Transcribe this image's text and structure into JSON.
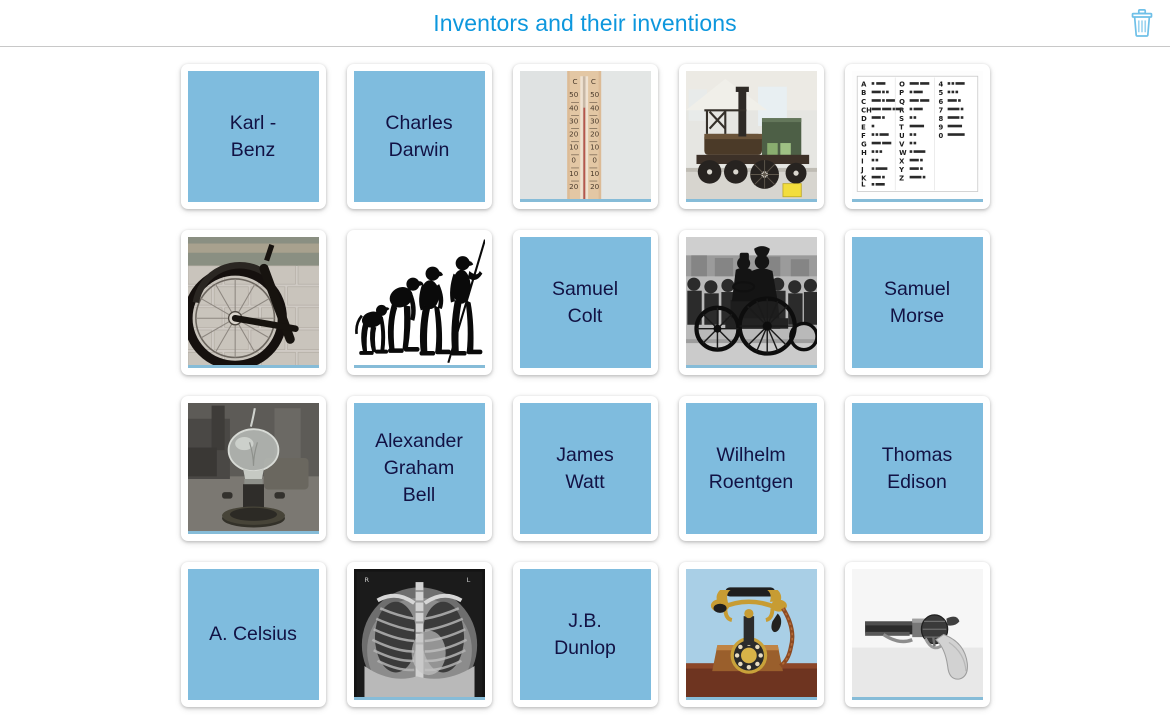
{
  "header": {
    "title": "Inventors and their inventions",
    "title_color": "#0d97dd",
    "delete_icon": "trash-icon",
    "delete_icon_color": "#6fc0e8",
    "delete_label": "Delete"
  },
  "theme": {
    "tile_color": "#7fbcde",
    "tile_text_color": "#121244",
    "card_background": "#ffffff",
    "page_background": "#ffffff",
    "image_underline_color": "#86bcd8",
    "header_rule_color": "#c8c8c8"
  },
  "grid": {
    "columns": 5,
    "rows": 4,
    "total_cards": 20
  },
  "cards": [
    {
      "id": 1,
      "type": "text",
      "label": "Karl -\nBenz",
      "name": "card-karl-benz"
    },
    {
      "id": 2,
      "type": "text",
      "label": "Charles\nDarwin",
      "name": "card-charles-darwin"
    },
    {
      "id": 3,
      "type": "image",
      "art": "thermometer",
      "alt": "Wooden wall thermometer in Celsius",
      "name": "card-thermometer"
    },
    {
      "id": 4,
      "type": "image",
      "art": "locomotive",
      "alt": "Early steam locomotive in a museum",
      "name": "card-steam-locomotive"
    },
    {
      "id": 5,
      "type": "image",
      "art": "morse-chart",
      "alt": "Morse code alphabet chart",
      "name": "card-morse-code-chart"
    },
    {
      "id": 6,
      "type": "image",
      "art": "bicycle",
      "alt": "Bicycle wheel with pneumatic tyre",
      "name": "card-bicycle-wheel"
    },
    {
      "id": 7,
      "type": "image",
      "art": "evolution",
      "alt": "Evolution of man silhouettes",
      "name": "card-evolution"
    },
    {
      "id": 8,
      "type": "text",
      "label": "Samuel\nColt",
      "name": "card-samuel-colt"
    },
    {
      "id": 9,
      "type": "image",
      "art": "motorwagen",
      "alt": "Historic photo of an early motorcar",
      "name": "card-early-automobile"
    },
    {
      "id": 10,
      "type": "text",
      "label": "Samuel\nMorse",
      "name": "card-samuel-morse"
    },
    {
      "id": 11,
      "type": "image",
      "art": "lightbulb",
      "alt": "Early incandescent light bulb",
      "name": "card-light-bulb"
    },
    {
      "id": 12,
      "type": "text",
      "label": "Alexander\nGraham\nBell",
      "name": "card-alexander-graham-bell"
    },
    {
      "id": 13,
      "type": "text",
      "label": "James\nWatt",
      "name": "card-james-watt"
    },
    {
      "id": 14,
      "type": "text",
      "label": "Wilhelm\nRoentgen",
      "name": "card-wilhelm-roentgen"
    },
    {
      "id": 15,
      "type": "text",
      "label": "Thomas\nEdison",
      "name": "card-thomas-edison"
    },
    {
      "id": 16,
      "type": "text",
      "label": "A. Celsius",
      "name": "card-a-celsius"
    },
    {
      "id": 17,
      "type": "image",
      "art": "xray",
      "alt": "Chest X-ray radiograph",
      "name": "card-chest-xray"
    },
    {
      "id": 18,
      "type": "text",
      "label": "J.B.\nDunlop",
      "name": "card-jb-dunlop"
    },
    {
      "id": 19,
      "type": "image",
      "art": "telephone",
      "alt": "Antique brass candlestick telephone",
      "name": "card-antique-telephone"
    },
    {
      "id": 20,
      "type": "image",
      "art": "revolver",
      "alt": "Colt percussion revolver",
      "name": "card-revolver"
    }
  ]
}
